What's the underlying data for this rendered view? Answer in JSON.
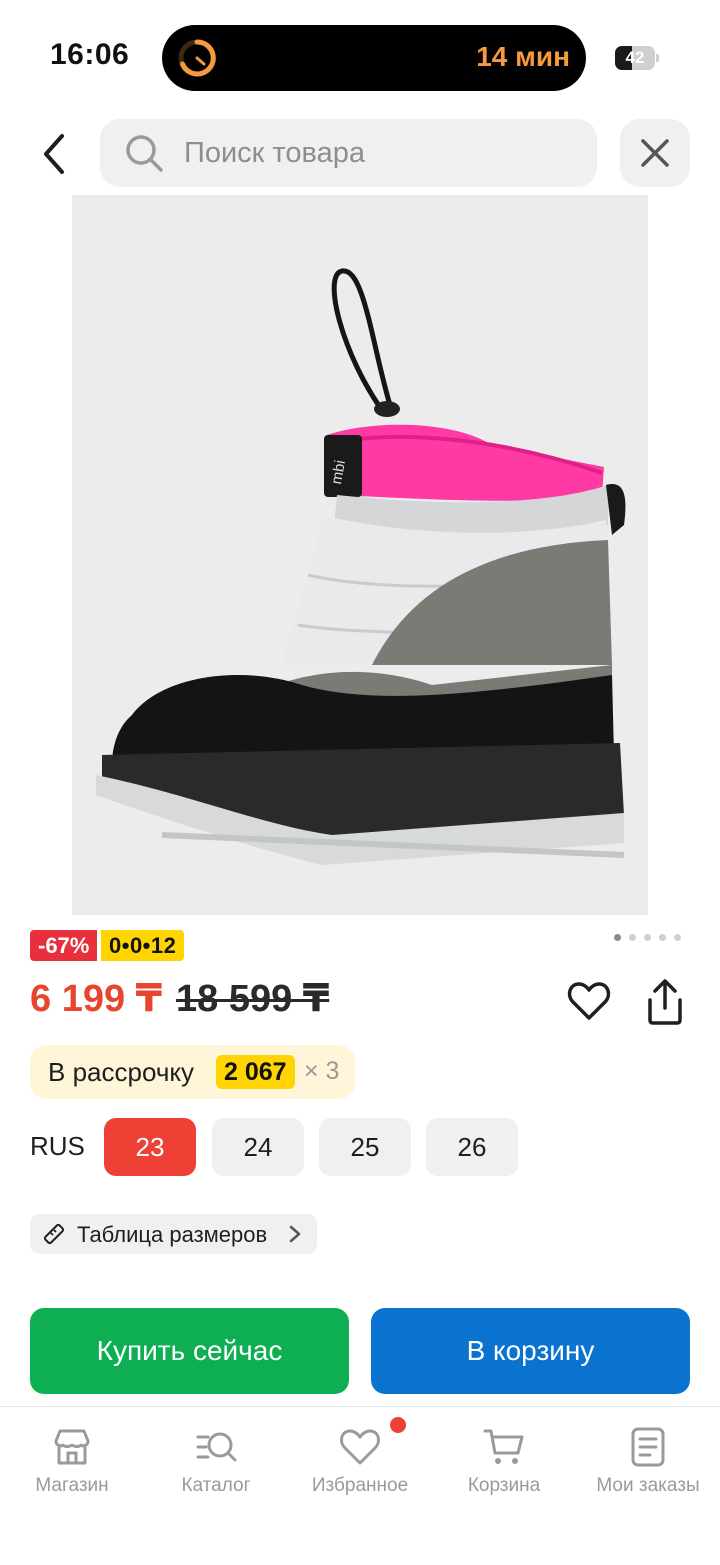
{
  "status_bar": {
    "time": "16:06",
    "island_text": "14 мин",
    "battery": "42",
    "battery_level": 0.42
  },
  "header": {
    "search_placeholder": "Поиск товара"
  },
  "gallery": {
    "image_count": 5,
    "current_index": 0
  },
  "badges": {
    "discount": "-67%",
    "installment": "0•0•12"
  },
  "price": {
    "current": "6 199 ₸",
    "old": "18 599 ₸"
  },
  "installment": {
    "label": "В рассрочку",
    "amount": "2 067",
    "times": "× 3"
  },
  "sizes": {
    "system": "RUS",
    "options": [
      "23",
      "24",
      "25",
      "26"
    ],
    "selected": "23"
  },
  "size_table": {
    "label": "Таблица размеров"
  },
  "actions": {
    "buy_now": "Купить сейчас",
    "add_to_cart": "В корзину"
  },
  "bottom_nav": [
    {
      "label": "Магазин",
      "icon": "store-icon"
    },
    {
      "label": "Каталог",
      "icon": "catalog-search-icon"
    },
    {
      "label": "Избранное",
      "icon": "heart-icon",
      "badge": true
    },
    {
      "label": "Корзина",
      "icon": "cart-icon"
    },
    {
      "label": "Мои заказы",
      "icon": "orders-icon"
    }
  ],
  "colors": {
    "discount_red": "#e8303c",
    "price_red": "#e8452e",
    "installment_yellow": "#ffd400",
    "buy_green": "#0eaf52",
    "cart_blue": "#0a72cf",
    "selected_size": "#ef4035"
  }
}
